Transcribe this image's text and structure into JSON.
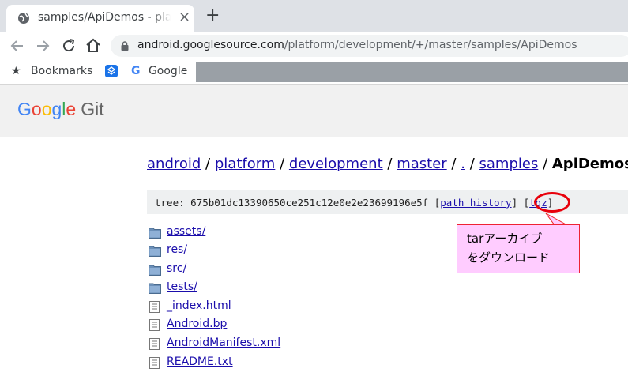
{
  "tab": {
    "title": "samples/ApiDemos - platform/development - Git at Google",
    "close": "×",
    "new_tab": "+"
  },
  "omnibox": {
    "domain": "android.googlesource.com",
    "path": "/platform/development/+/master/samples/ApiDemos"
  },
  "bookmarks": [
    {
      "label": "Bookmarks",
      "icon": "star-icon"
    },
    {
      "label": "",
      "icon": "app-icon"
    },
    {
      "label": "Google",
      "icon": "google-icon"
    }
  ],
  "header": {
    "logo_google": "Google",
    "logo_git": "Git",
    "logo_colors": [
      "#4285f4",
      "#ea4335",
      "#fbbc05",
      "#4285f4",
      "#34a853",
      "#ea4335"
    ]
  },
  "breadcrumbs": {
    "items": [
      "android",
      "platform",
      "development",
      "master",
      ".",
      "samples"
    ],
    "separator": "/",
    "current": "ApiDemos"
  },
  "tree": {
    "label": "tree:",
    "hash": "675b01dc13390650ce251c12e0e2e23699196e5f",
    "path_history": "path history",
    "tgz": "tgz"
  },
  "callout": {
    "line1": "tarアーカイブ",
    "line2": "をダウンロード",
    "highlight_color": "#e8000b",
    "fill": "#ffccff"
  },
  "files": [
    {
      "name": "assets/",
      "kind": "folder"
    },
    {
      "name": "res/",
      "kind": "folder"
    },
    {
      "name": "src/",
      "kind": "folder"
    },
    {
      "name": "tests/",
      "kind": "folder"
    },
    {
      "name": "_index.html",
      "kind": "file"
    },
    {
      "name": "Android.bp",
      "kind": "file"
    },
    {
      "name": "AndroidManifest.xml",
      "kind": "file"
    },
    {
      "name": "README.txt",
      "kind": "file"
    }
  ]
}
